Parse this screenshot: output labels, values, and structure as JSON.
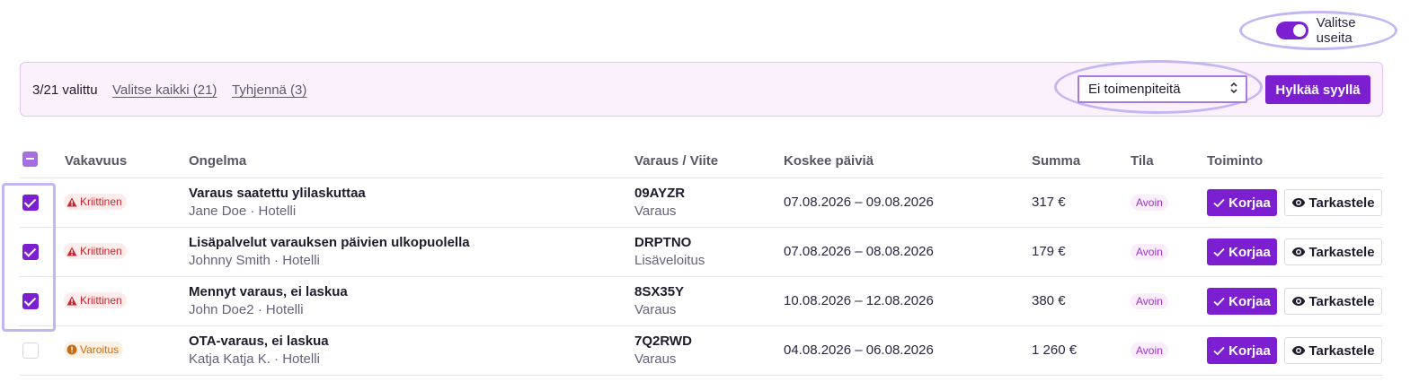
{
  "toggle": {
    "label": "Valitse useita",
    "on": true
  },
  "bulk": {
    "selected_count": "3/21 valittu",
    "select_all": "Valitse kaikki (21)",
    "clear": "Tyhjennä (3)",
    "action_select": {
      "value": "Ei toimenpiteitä"
    },
    "reject_button": "Hylkää syyllä"
  },
  "table": {
    "headers": {
      "severity": "Vakavuus",
      "problem": "Ongelma",
      "reference": "Varaus / Viite",
      "dates": "Koskee päiviä",
      "amount": "Summa",
      "status": "Tila",
      "action": "Toiminto"
    },
    "rows": [
      {
        "checked": true,
        "severity": "Kriittinen",
        "severity_level": "critical",
        "title": "Varaus saatettu ylilaskuttaa",
        "subtitle": "Jane Doe · Hotelli",
        "ref_id": "09AYZR",
        "ref_type": "Varaus",
        "dates": "07.08.2026 – 09.08.2026",
        "amount": "317 €",
        "status": "Avoin",
        "fix": "Korjaa",
        "view": "Tarkastele"
      },
      {
        "checked": true,
        "severity": "Kriittinen",
        "severity_level": "critical",
        "title": "Lisäpalvelut varauksen päivien ulkopuolella",
        "subtitle": "Johnny Smith · Hotelli",
        "ref_id": "DRPTNO",
        "ref_type": "Lisäveloitus",
        "dates": "07.08.2026 – 08.08.2026",
        "amount": "179 €",
        "status": "Avoin",
        "fix": "Korjaa",
        "view": "Tarkastele"
      },
      {
        "checked": true,
        "severity": "Kriittinen",
        "severity_level": "critical",
        "title": "Mennyt varaus, ei laskua",
        "subtitle": "John Doe2 · Hotelli",
        "ref_id": "8SX35Y",
        "ref_type": "Varaus",
        "dates": "10.08.2026 – 12.08.2026",
        "amount": "380 €",
        "status": "Avoin",
        "fix": "Korjaa",
        "view": "Tarkastele"
      },
      {
        "checked": false,
        "severity": "Varoitus",
        "severity_level": "warning",
        "title": "OTA-varaus, ei laskua",
        "subtitle": "Katja Katja K. · Hotelli",
        "ref_id": "7Q2RWD",
        "ref_type": "Varaus",
        "dates": "04.08.2026 – 06.08.2026",
        "amount": "1 260 €",
        "status": "Avoin",
        "fix": "Korjaa",
        "view": "Tarkastele"
      }
    ]
  },
  "colors": {
    "accent": "#7b1fd0",
    "highlight_ring": "#c3b6f2",
    "critical": "#c8242b",
    "warning": "#c76a12",
    "status": "#a22fc7"
  },
  "icons": {
    "critical": "warning-triangle-icon",
    "warning": "exclamation-circle-icon",
    "fix": "checkmark-icon",
    "view": "eye-icon",
    "select": "chevron-updown-icon"
  }
}
